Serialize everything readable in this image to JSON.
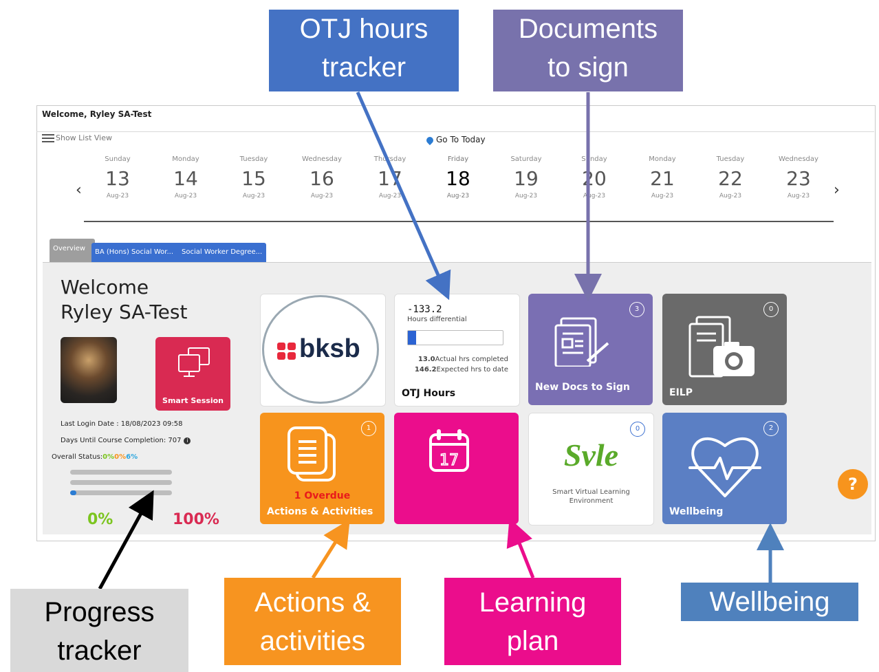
{
  "welcome_bar": "Welcome, Ryley SA-Test",
  "list_view": "Show List View",
  "go_today": "Go To Today",
  "calendar": [
    {
      "day": "Sunday",
      "date": "13",
      "month": "Aug-23"
    },
    {
      "day": "Monday",
      "date": "14",
      "month": "Aug-23"
    },
    {
      "day": "Tuesday",
      "date": "15",
      "month": "Aug-23"
    },
    {
      "day": "Wednesday",
      "date": "16",
      "month": "Aug-23"
    },
    {
      "day": "Thursday",
      "date": "17",
      "month": "Aug-23"
    },
    {
      "day": "Friday",
      "date": "18",
      "month": "Aug-23"
    },
    {
      "day": "Saturday",
      "date": "19",
      "month": "Aug-23"
    },
    {
      "day": "Sunday",
      "date": "20",
      "month": "Aug-23"
    },
    {
      "day": "Monday",
      "date": "21",
      "month": "Aug-23"
    },
    {
      "day": "Tuesday",
      "date": "22",
      "month": "Aug-23"
    },
    {
      "day": "Wednesday",
      "date": "23",
      "month": "Aug-23"
    }
  ],
  "tabs": {
    "overview": "Overview",
    "ba": "BA (Hons) Social Wor...",
    "sw": "Social Worker Degree..."
  },
  "profile": {
    "welcome_line1": "Welcome",
    "welcome_line2": "Ryley SA-Test",
    "smart_session": "Smart Session",
    "last_login": "Last Login Date : 18/08/2023 09:58",
    "days_until": "Days Until Course Completion: 707",
    "overall_status_label": "Overall Status:",
    "overall_status_values": [
      "0%",
      "0%",
      "6%"
    ],
    "progress_levels": [
      0,
      0,
      0.06
    ],
    "pct_low": "0%",
    "pct_high": "100%"
  },
  "tiles": {
    "bksb": "bksb",
    "otj": {
      "value": "-133.2",
      "sub": "Hours differential",
      "actual_val": "13.0",
      "actual_label": "Actual hrs completed",
      "expected_val": "146.2",
      "expected_label": "Expected hrs to date",
      "title": "OTJ Hours",
      "progress": 0.09
    },
    "docs": {
      "title": "New Docs to Sign",
      "badge": "3"
    },
    "eilp": {
      "title": "EILP",
      "badge": "0"
    },
    "actions": {
      "overdue": "1 Overdue",
      "title": "Actions & Activities",
      "badge": "1"
    },
    "learn": {
      "calendar_number": "17"
    },
    "svle": {
      "logo": "Svle",
      "line1": "Smart Virtual Learning",
      "line2": "Environment",
      "badge": "0"
    },
    "well": {
      "title": "Wellbeing",
      "badge": "2"
    }
  },
  "help": "?",
  "callouts": {
    "otj": [
      "OTJ hours",
      "tracker"
    ],
    "docs": [
      "Documents",
      "to sign"
    ],
    "progress": [
      "Progress",
      "tracker"
    ],
    "actions": [
      "Actions &",
      "activities"
    ],
    "learning": [
      "Learning",
      "plan"
    ],
    "wellbeing": [
      "Wellbeing"
    ]
  },
  "colors": {
    "otj_callout": "#4472c4",
    "docs_callout": "#7872ac",
    "progress_callout": "#d9d9d9",
    "actions_callout": "#f79420",
    "learning_callout": "#eb0d8c",
    "wellbeing_callout": "#4f81bd"
  }
}
